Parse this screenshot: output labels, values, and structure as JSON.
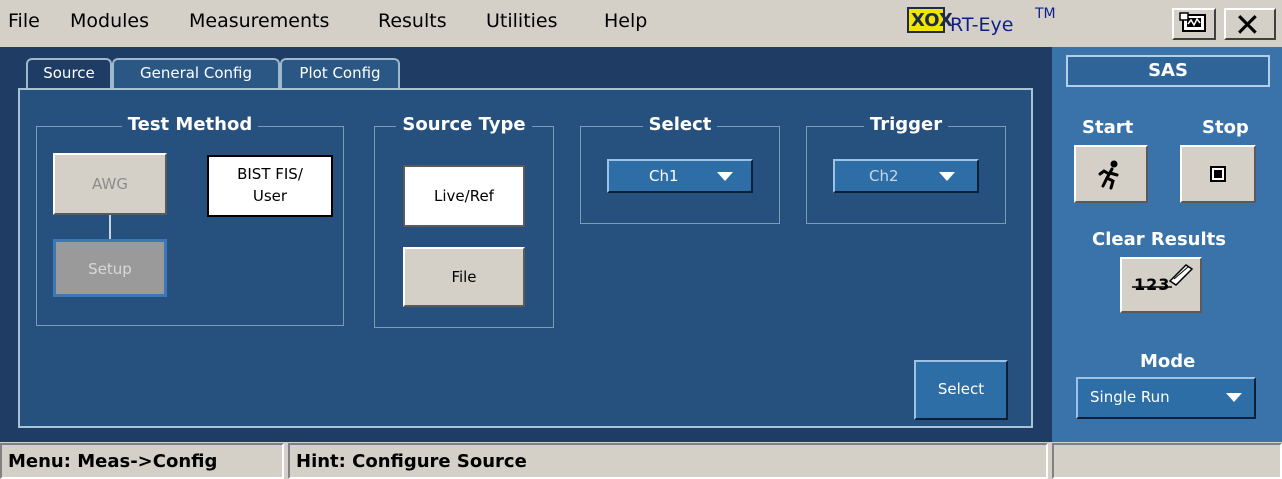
{
  "menu": [
    "File",
    "Modules",
    "Measurements",
    "Results",
    "Utilities",
    "Help"
  ],
  "brand": {
    "logo_text": "XOX",
    "name": "RT-Eye",
    "tm": "TM"
  },
  "window_buttons": {
    "display_icon": "display-toggle-icon",
    "close_icon": "close-icon",
    "close_glyph": "✕"
  },
  "tabs": [
    "Source",
    "General Config",
    "Plot Config"
  ],
  "groups": {
    "test_method": {
      "title": "Test Method",
      "awg_label": "AWG",
      "bist_line1": "BIST FIS/",
      "bist_line2": "User",
      "setup_label": "Setup"
    },
    "source_type": {
      "title": "Source Type",
      "live_ref_label": "Live/Ref",
      "file_label": "File"
    },
    "select": {
      "title": "Select",
      "value": "Ch1"
    },
    "trigger": {
      "title": "Trigger",
      "value": "Ch2"
    }
  },
  "select_button": "Select",
  "side": {
    "standard": "SAS",
    "start_label": "Start",
    "stop_label": "Stop",
    "start_icon": "running-man-icon",
    "stop_icon": "stop-square-icon",
    "clear_label": "Clear Results",
    "clear_icon_text": "123",
    "mode_label": "Mode",
    "mode_value": "Single Run"
  },
  "status": {
    "menu": "Menu: Meas->Config",
    "hint": "Hint: Configure Source"
  },
  "colors": {
    "panel_dark": "#1e3c64",
    "panel_inner": "#26507d",
    "side_panel": "#3a73aa",
    "dropdown": "#2e6ea6",
    "chrome": "#d4d0c8"
  }
}
